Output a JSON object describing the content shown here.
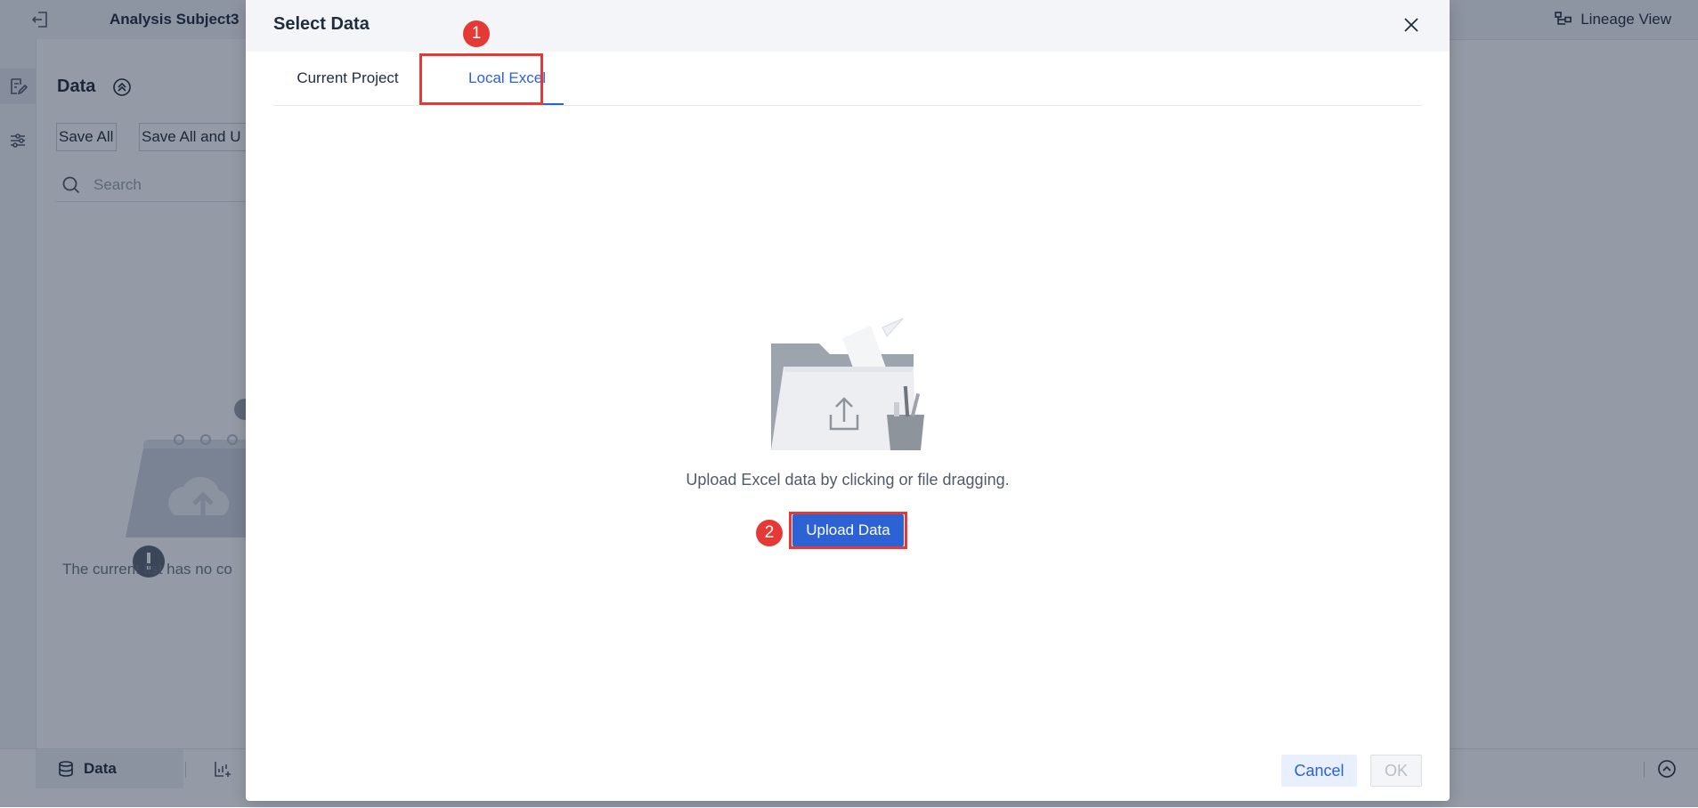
{
  "app": {
    "subject_name": "Analysis Subject3",
    "lineage_label": "Lineage View"
  },
  "data_panel": {
    "title": "Data",
    "save_all_label": "Save All",
    "save_all_update_label": "Save All and U",
    "search_placeholder": "Search",
    "empty_text": "The current list has no co"
  },
  "bottom_bar": {
    "data_tab_label": "Data"
  },
  "dialog": {
    "title": "Select Data",
    "tabs": [
      {
        "label": "Current Project",
        "active": false
      },
      {
        "label": "Local Excel",
        "active": true
      }
    ],
    "upload_hint": "Upload Excel data by clicking or file dragging.",
    "upload_button": "Upload Data",
    "cancel_button": "Cancel",
    "ok_button": "OK"
  },
  "annotations": {
    "step1": "1",
    "step2": "2"
  },
  "colors": {
    "accent": "#2d62d4",
    "annotation_red": "#e53935",
    "overlay": "rgba(20,34,58,0.45)"
  },
  "icons": [
    "exit-icon",
    "lineage-icon",
    "edit-icon",
    "filter-icon",
    "collapse-up-icon",
    "search-icon",
    "database-icon",
    "add-chart-icon",
    "expand-up-icon",
    "close-icon",
    "upload-folder-illustration",
    "empty-calendar-illustration"
  ]
}
